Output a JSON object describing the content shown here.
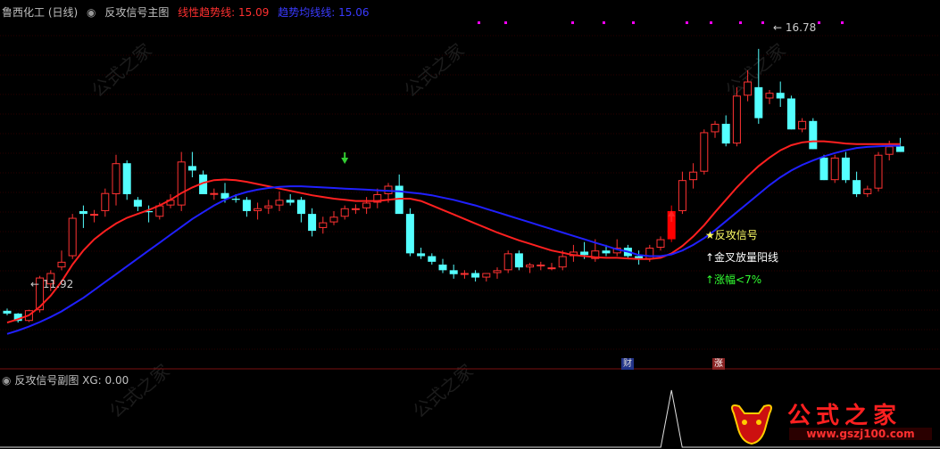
{
  "header": {
    "stock": "鲁西化工 (日线)",
    "indicator": "反攻信号主图",
    "line1_label": "线性趋势线:",
    "line1_value": "15.09",
    "line2_label": "趋势均线线:",
    "line2_value": "15.06"
  },
  "sub_header": {
    "indicator": "反攻信号副图",
    "xg_label": "XG:",
    "xg_value": "0.00"
  },
  "annotations": {
    "high_label": "16.78",
    "low_label": "11.92",
    "signal": "★反攻信号",
    "cond1": "↑金叉放量阳线",
    "cond2": "↑涨幅<7%"
  },
  "badges": {
    "cai": "财",
    "zhang": "涨"
  },
  "watermark": {
    "text": "公式之家",
    "url": "www.gszj100.com"
  },
  "colors": {
    "background": "#000000",
    "up": "#ff3232",
    "down": "#54ffff",
    "line1": "#ff2020",
    "line2": "#2020ff",
    "signal_bar": "#ff0000",
    "dots": "#ff00ff",
    "header_text": "#c0c0c0",
    "signal_text": "#ffff66",
    "cond_text": "#ffffff",
    "cond2_text": "#32ff32"
  },
  "chart_data": {
    "type": "candlestick",
    "price_range": [
      11.4,
      17.3
    ],
    "ohlc": [
      [
        12.13,
        12.17,
        12.05,
        12.08
      ],
      [
        12.08,
        12.09,
        11.92,
        11.95
      ],
      [
        11.95,
        12.15,
        11.93,
        12.14
      ],
      [
        12.14,
        12.75,
        12.1,
        12.72
      ],
      [
        12.6,
        12.85,
        12.48,
        12.8
      ],
      [
        12.9,
        13.2,
        12.85,
        13.0
      ],
      [
        13.1,
        13.85,
        13.05,
        13.78
      ],
      [
        13.9,
        14.0,
        13.6,
        13.85
      ],
      [
        13.85,
        13.92,
        13.7,
        13.85
      ],
      [
        13.9,
        14.3,
        13.8,
        14.22
      ],
      [
        14.2,
        14.9,
        14.0,
        14.75
      ],
      [
        14.75,
        14.8,
        14.1,
        14.2
      ],
      [
        14.1,
        14.15,
        13.9,
        13.98
      ],
      [
        13.9,
        14.0,
        13.7,
        13.88
      ],
      [
        13.8,
        14.05,
        13.75,
        14.0
      ],
      [
        14.0,
        14.2,
        13.95,
        14.1
      ],
      [
        14.0,
        14.95,
        13.9,
        14.78
      ],
      [
        14.7,
        14.95,
        14.5,
        14.62
      ],
      [
        14.55,
        14.62,
        14.2,
        14.2
      ],
      [
        14.2,
        14.3,
        14.1,
        14.22
      ],
      [
        14.22,
        14.4,
        14.05,
        14.12
      ],
      [
        14.12,
        14.2,
        14.05,
        14.1
      ],
      [
        14.1,
        14.15,
        13.8,
        13.9
      ],
      [
        13.9,
        14.05,
        13.75,
        13.95
      ],
      [
        13.95,
        14.1,
        13.85,
        14.0
      ],
      [
        14.0,
        14.25,
        13.9,
        14.1
      ],
      [
        14.1,
        14.2,
        14.0,
        14.05
      ],
      [
        14.1,
        14.15,
        13.7,
        13.85
      ],
      [
        13.85,
        13.95,
        13.45,
        13.55
      ],
      [
        13.6,
        13.8,
        13.5,
        13.7
      ],
      [
        13.7,
        13.9,
        13.65,
        13.8
      ],
      [
        13.8,
        14.0,
        13.75,
        13.95
      ],
      [
        13.95,
        14.02,
        13.85,
        13.95
      ],
      [
        13.95,
        14.15,
        13.85,
        14.05
      ],
      [
        14.05,
        14.3,
        13.95,
        14.2
      ],
      [
        14.2,
        14.4,
        14.05,
        14.35
      ],
      [
        14.35,
        14.55,
        13.95,
        13.85
      ],
      [
        13.85,
        13.95,
        13.1,
        13.15
      ],
      [
        13.15,
        13.25,
        13.05,
        13.1
      ],
      [
        13.1,
        13.15,
        12.95,
        13.0
      ],
      [
        12.95,
        13.05,
        12.8,
        12.85
      ],
      [
        12.85,
        12.95,
        12.7,
        12.78
      ],
      [
        12.78,
        12.85,
        12.7,
        12.8
      ],
      [
        12.8,
        12.85,
        12.65,
        12.72
      ],
      [
        12.72,
        12.8,
        12.65,
        12.8
      ],
      [
        12.8,
        12.9,
        12.7,
        12.85
      ],
      [
        12.85,
        13.2,
        12.8,
        13.15
      ],
      [
        13.15,
        13.2,
        12.85,
        12.9
      ],
      [
        12.9,
        12.98,
        12.8,
        12.95
      ],
      [
        12.95,
        13.0,
        12.85,
        12.95
      ],
      [
        12.9,
        12.98,
        12.85,
        12.9
      ],
      [
        12.9,
        13.2,
        12.85,
        13.1
      ],
      [
        13.1,
        13.3,
        13.0,
        13.18
      ],
      [
        13.18,
        13.35,
        13.05,
        13.12
      ],
      [
        13.05,
        13.4,
        13.0,
        13.2
      ],
      [
        13.2,
        13.3,
        13.1,
        13.15
      ],
      [
        13.15,
        13.4,
        13.1,
        13.25
      ],
      [
        13.25,
        13.3,
        13.05,
        13.1
      ],
      [
        13.1,
        13.2,
        12.95,
        13.05
      ],
      [
        13.05,
        13.3,
        13.0,
        13.25
      ],
      [
        13.25,
        13.45,
        13.2,
        13.4
      ],
      [
        13.4,
        14.0,
        13.35,
        13.9
      ],
      [
        13.9,
        14.6,
        13.85,
        14.45
      ],
      [
        14.45,
        14.75,
        14.3,
        14.6
      ],
      [
        14.6,
        15.35,
        14.55,
        15.3
      ],
      [
        15.3,
        15.5,
        15.2,
        15.45
      ],
      [
        15.45,
        15.6,
        15.05,
        15.1
      ],
      [
        15.1,
        16.1,
        15.05,
        15.95
      ],
      [
        15.95,
        16.4,
        15.85,
        16.2
      ],
      [
        16.1,
        16.78,
        15.45,
        15.55
      ],
      [
        15.9,
        16.05,
        15.8,
        16.0
      ],
      [
        16.0,
        16.2,
        15.75,
        15.9
      ],
      [
        15.9,
        15.95,
        15.35,
        15.35
      ],
      [
        15.35,
        15.55,
        15.3,
        15.5
      ],
      [
        15.5,
        15.55,
        15.0,
        15.0
      ],
      [
        14.85,
        14.9,
        14.45,
        14.45
      ],
      [
        14.45,
        14.9,
        14.4,
        14.85
      ],
      [
        14.85,
        14.95,
        14.4,
        14.45
      ],
      [
        14.45,
        14.6,
        14.15,
        14.2
      ],
      [
        14.2,
        14.35,
        14.15,
        14.3
      ],
      [
        14.3,
        14.95,
        14.25,
        14.9
      ],
      [
        14.9,
        15.15,
        14.8,
        15.05
      ],
      [
        15.05,
        15.2,
        14.95,
        14.95
      ]
    ],
    "line1": [
      11.92,
      11.98,
      12.05,
      12.2,
      12.4,
      12.65,
      12.95,
      13.2,
      13.4,
      13.55,
      13.68,
      13.78,
      13.85,
      13.92,
      14.0,
      14.1,
      14.22,
      14.32,
      14.4,
      14.45,
      14.46,
      14.45,
      14.42,
      14.38,
      14.34,
      14.3,
      14.26,
      14.22,
      14.18,
      14.15,
      14.12,
      14.1,
      14.08,
      14.08,
      14.08,
      14.1,
      14.12,
      14.12,
      14.08,
      14.0,
      13.92,
      13.84,
      13.76,
      13.68,
      13.6,
      13.52,
      13.45,
      13.38,
      13.32,
      13.26,
      13.2,
      13.16,
      13.12,
      13.1,
      13.08,
      13.07,
      13.07,
      13.06,
      13.05,
      13.05,
      13.07,
      13.15,
      13.28,
      13.45,
      13.65,
      13.88,
      14.1,
      14.32,
      14.52,
      14.7,
      14.85,
      14.98,
      15.07,
      15.12,
      15.14,
      15.14,
      15.12,
      15.1,
      15.09,
      15.09,
      15.09,
      15.09,
      15.09
    ],
    "line2": [
      11.72,
      11.78,
      11.85,
      11.93,
      12.02,
      12.12,
      12.24,
      12.36,
      12.5,
      12.64,
      12.78,
      12.92,
      13.06,
      13.2,
      13.34,
      13.48,
      13.62,
      13.76,
      13.88,
      14.0,
      14.1,
      14.18,
      14.24,
      14.28,
      14.31,
      14.33,
      14.34,
      14.34,
      14.33,
      14.32,
      14.31,
      14.3,
      14.29,
      14.28,
      14.27,
      14.26,
      14.25,
      14.23,
      14.21,
      14.18,
      14.14,
      14.1,
      14.05,
      14.0,
      13.94,
      13.88,
      13.82,
      13.76,
      13.7,
      13.64,
      13.58,
      13.52,
      13.46,
      13.4,
      13.34,
      13.28,
      13.22,
      13.18,
      13.12,
      13.1,
      13.1,
      13.13,
      13.2,
      13.3,
      13.42,
      13.56,
      13.72,
      13.88,
      14.04,
      14.2,
      14.36,
      14.5,
      14.62,
      14.72,
      14.8,
      14.87,
      14.93,
      14.98,
      15.02,
      15.04,
      15.05,
      15.06,
      15.06
    ],
    "signal_index": 61,
    "sub_indicator": {
      "name": "XG",
      "value": 0.0,
      "spike_index": 61
    }
  }
}
